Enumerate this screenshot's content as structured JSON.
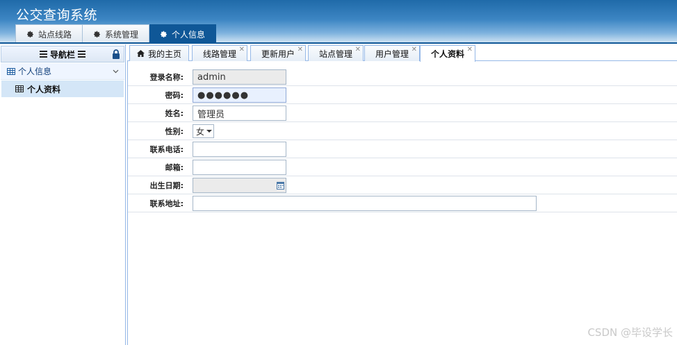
{
  "app": {
    "title": "公交查询系统"
  },
  "top_nav": {
    "tabs": [
      {
        "label": "站点线路",
        "icon": "gear-icon"
      },
      {
        "label": "系统管理",
        "icon": "gear-icon"
      },
      {
        "label": "个人信息",
        "icon": "gear-icon",
        "active": true
      }
    ]
  },
  "sidebar": {
    "title": "导航栏",
    "group": {
      "label": "个人信息",
      "icon": "table-icon"
    },
    "items": [
      {
        "label": "个人资料",
        "icon": "table-icon"
      }
    ]
  },
  "content_tabs": [
    {
      "label": "我的主页",
      "icon": "home-icon",
      "closable": false
    },
    {
      "label": "线路管理",
      "closable": true
    },
    {
      "label": "更新用户",
      "closable": true
    },
    {
      "label": "站点管理",
      "closable": true
    },
    {
      "label": "用户管理",
      "closable": true
    },
    {
      "label": "个人资料",
      "closable": true,
      "active": true
    }
  ],
  "form": {
    "login_name": {
      "label": "登录名称:",
      "value": "admin"
    },
    "password": {
      "label": "密码:",
      "value": "●●●●●●"
    },
    "name": {
      "label": "姓名:",
      "value": "管理员"
    },
    "gender": {
      "label": "性别:",
      "value": "女"
    },
    "phone": {
      "label": "联系电话:",
      "value": ""
    },
    "email": {
      "label": "邮箱:",
      "value": ""
    },
    "birthday": {
      "label": "出生日期:",
      "value": ""
    },
    "address": {
      "label": "联系地址:",
      "value": ""
    }
  },
  "watermark": "CSDN @毕设学长",
  "colors": {
    "header_dark": "#0f5797",
    "active_tab": "#0f5797",
    "border": "#95b8e7",
    "selected_row": "#d4e6f7"
  }
}
